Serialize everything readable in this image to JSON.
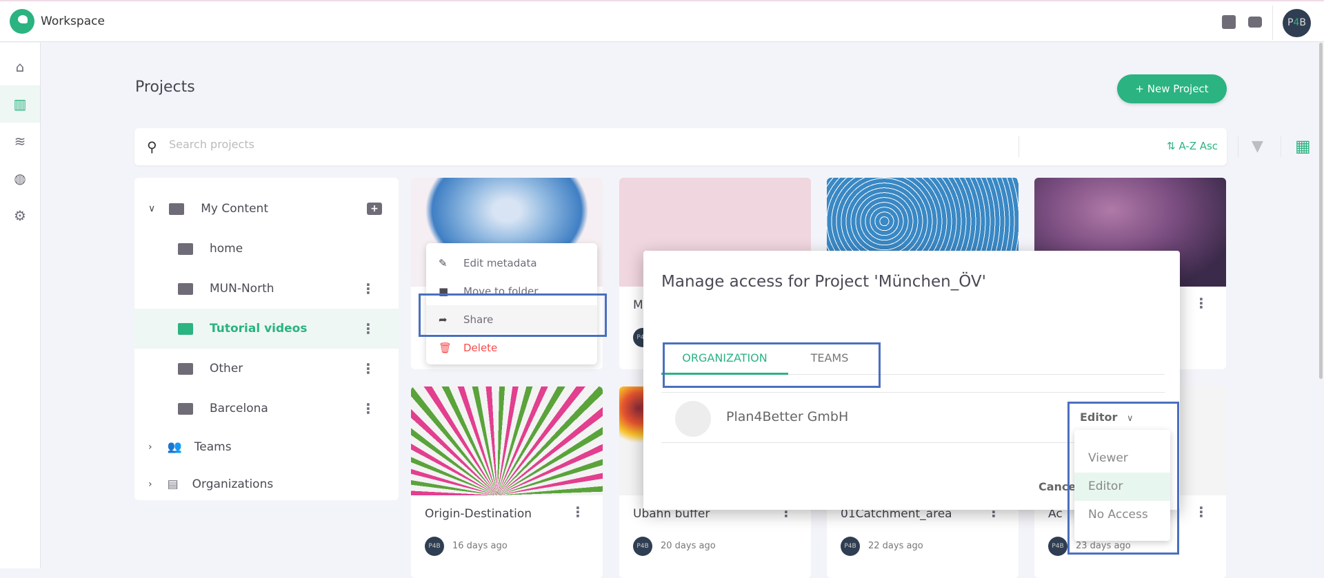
{
  "app": {
    "title": "Workspace",
    "avatar_initials": "P4B"
  },
  "header": {
    "icons": [
      "book-icon",
      "server-icon"
    ]
  },
  "sidebar": {
    "items": [
      {
        "icon": "home-icon",
        "glyph": "⌂"
      },
      {
        "icon": "map-icon",
        "glyph": "▥",
        "active": true
      },
      {
        "icon": "database-icon",
        "glyph": "≋"
      },
      {
        "icon": "globe-icon",
        "glyph": "◍"
      },
      {
        "icon": "settings-icon",
        "glyph": "⚙"
      }
    ]
  },
  "page": {
    "title": "Projects",
    "new_project": "+  New Project"
  },
  "search": {
    "placeholder": "Search projects",
    "sort_label": "A-Z Asc"
  },
  "tree": {
    "root": "My Content",
    "folders": [
      {
        "label": "home"
      },
      {
        "label": "MUN-North"
      },
      {
        "label": "Tutorial videos",
        "active": true
      },
      {
        "label": "Other"
      },
      {
        "label": "Barcelona"
      }
    ],
    "teams": "Teams",
    "organizations": "Organizations"
  },
  "cards": [
    {
      "title": "",
      "date": ""
    },
    {
      "title": "M",
      "date": ""
    },
    {
      "title": "",
      "date": ""
    },
    {
      "title": "",
      "date": ""
    },
    {
      "title": "Origin-Destination",
      "date": "16 days ago"
    },
    {
      "title": "Ubahn buffer",
      "date": "20 days ago"
    },
    {
      "title": "01Catchment_area",
      "date": "22 days ago"
    },
    {
      "title": "Ac",
      "date": "23 days ago"
    }
  ],
  "context_menu": {
    "items": [
      {
        "label": "Edit metadata",
        "icon": "edit-icon"
      },
      {
        "label": "Move to folder",
        "icon": "folder-icon"
      },
      {
        "label": "Share",
        "icon": "share-icon"
      },
      {
        "label": "Delete",
        "icon": "trash-icon"
      }
    ]
  },
  "dialog": {
    "title": "Manage access for Project 'München_ÖV'",
    "tabs": [
      "ORGANIZATION",
      "TEAMS"
    ],
    "org_name": "Plan4Better GmbH",
    "role": "Editor",
    "cancel": "Cancel"
  },
  "role_dropdown": {
    "options": [
      "Viewer",
      "Editor",
      "No Access"
    ],
    "selected": "Editor"
  },
  "colors": {
    "accent": "#2bb381",
    "danger": "#f44b4b",
    "highlight": "#4a6fbf"
  }
}
